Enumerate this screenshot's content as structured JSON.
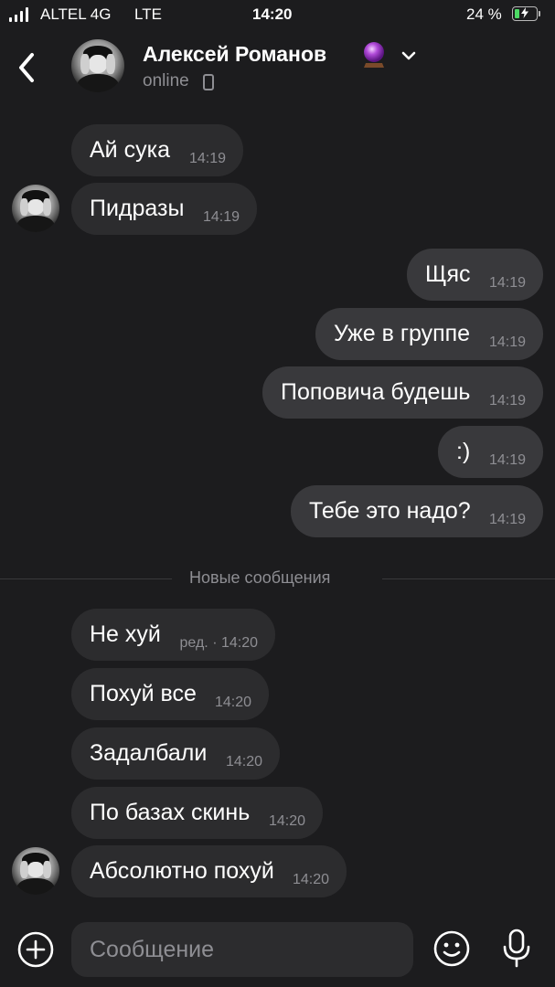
{
  "status_bar": {
    "carrier": "ALTEL 4G",
    "network": "LTE",
    "time": "14:20",
    "battery_percent": "24 %",
    "battery_level": 0.24
  },
  "header": {
    "contact_name": "Алексей Романов",
    "status": "online",
    "name_emoji": "crystal-ball-icon"
  },
  "messages": [
    {
      "dir": "in",
      "text": "Ай сука",
      "time": "14:19"
    },
    {
      "dir": "in",
      "text": "Пидразы",
      "time": "14:19"
    },
    {
      "dir": "out",
      "text": "Щяс",
      "time": "14:19"
    },
    {
      "dir": "out",
      "text": "Уже в группе",
      "time": "14:19"
    },
    {
      "dir": "out",
      "text": "Поповича будешь",
      "time": "14:19"
    },
    {
      "dir": "out",
      "text": ":)",
      "time": "14:19"
    },
    {
      "dir": "out",
      "text": "Тебе это надо?",
      "time": "14:19"
    },
    {
      "dir": "in",
      "text": "Не хуй",
      "time": "ред. · 14:20"
    },
    {
      "dir": "in",
      "text": "Похуй все",
      "time": "14:20"
    },
    {
      "dir": "in",
      "text": "Задалбали",
      "time": "14:20"
    },
    {
      "dir": "in",
      "text": "По базах скинь",
      "time": "14:20"
    },
    {
      "dir": "in",
      "text": "Абсолютно похуй",
      "time": "14:20"
    }
  ],
  "new_messages_divider": "Новые сообщения",
  "composer": {
    "placeholder": "Сообщение"
  },
  "colors": {
    "background": "#1c1c1e",
    "incoming_bubble": "#2c2c2e",
    "outgoing_bubble": "#39393c",
    "secondary_text": "#8e8e93",
    "battery": "#4cd964"
  }
}
